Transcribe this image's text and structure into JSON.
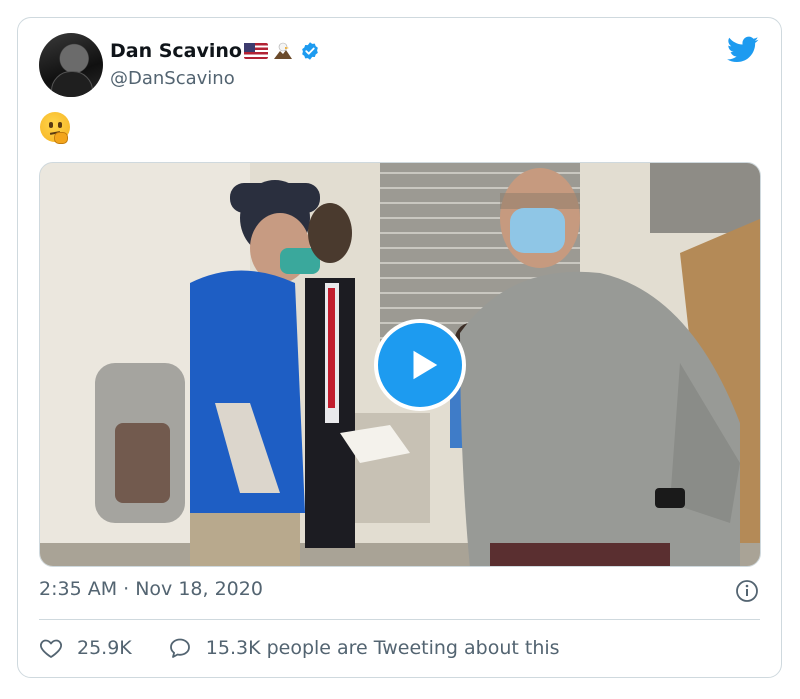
{
  "author": {
    "name": "Dan Scavino",
    "handle": "@DanScavino",
    "avatar_icon": "profile-photo",
    "badges": [
      "us-flag-emoji",
      "eagle-emoji",
      "verified-badge-icon"
    ]
  },
  "tweet": {
    "text_emoji": "thinking-face-emoji",
    "media_type": "video",
    "timestamp": "2:35 AM · Nov 18, 2020",
    "likes": "25.9K",
    "tweeting_about": "15.3K people are Tweeting about this"
  },
  "icons": {
    "brand": "twitter-bird-icon",
    "info": "info-icon",
    "like": "heart-icon",
    "reply": "speech-bubble-icon",
    "play": "play-icon"
  },
  "colors": {
    "accent": "#1d9bf0",
    "text": "#0f1419",
    "secondary": "#536471",
    "border": "#cfd9de"
  }
}
